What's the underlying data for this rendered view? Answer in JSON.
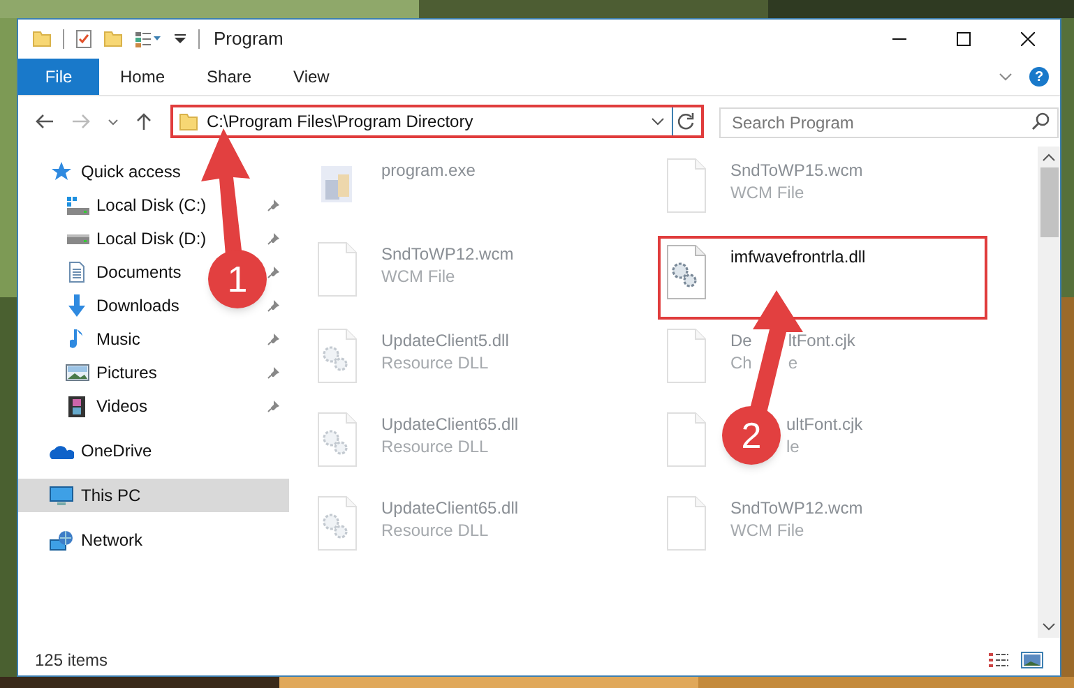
{
  "window": {
    "title": "Program"
  },
  "ribbon": {
    "tabs": [
      {
        "label": "File",
        "kind": "file",
        "selected": false
      },
      {
        "label": "Home",
        "kind": "tab",
        "selected": false
      },
      {
        "label": "Share",
        "kind": "tab",
        "selected": false
      },
      {
        "label": "View",
        "kind": "tab",
        "selected": false
      }
    ],
    "help": "?"
  },
  "address": {
    "path": "C:\\Program Files\\Program Directory",
    "highlighted": true
  },
  "search": {
    "placeholder": "Search Program"
  },
  "nav": [
    {
      "label": "Quick access",
      "kind": "star",
      "selected": false,
      "children": [
        {
          "label": "Local Disk (C:)",
          "kind": "drive_windows",
          "pinned": true,
          "selected": false
        },
        {
          "label": "Local Disk (D:)",
          "kind": "drive",
          "pinned": true,
          "selected": false
        },
        {
          "label": "Documents",
          "kind": "documents",
          "pinned": true,
          "selected": false
        },
        {
          "label": "Downloads",
          "kind": "downloads",
          "pinned": true,
          "selected": false
        },
        {
          "label": "Music",
          "kind": "music",
          "pinned": true,
          "selected": false
        },
        {
          "label": "Pictures",
          "kind": "pictures",
          "pinned": true,
          "selected": false
        },
        {
          "label": "Videos",
          "kind": "videos",
          "pinned": true,
          "selected": false
        }
      ]
    },
    {
      "label": "OneDrive",
      "kind": "cloud",
      "selected": false
    },
    {
      "label": "This PC",
      "kind": "pc",
      "selected": true
    },
    {
      "label": "Network",
      "kind": "network",
      "selected": false
    }
  ],
  "files": [
    {
      "name": "program.exe",
      "kind": "exe",
      "dimmed": true,
      "highlighted": false
    },
    {
      "name": "SndToWP15.wcm",
      "type": "WCM File",
      "kind": "document",
      "dimmed": true,
      "highlighted": false
    },
    {
      "name": "SndToWP12.wcm",
      "type": "WCM File",
      "kind": "document",
      "dimmed": true,
      "highlighted": false
    },
    {
      "name": "imfwavefrontrla.dll",
      "kind": "dll",
      "dimmed": false,
      "highlighted": true
    },
    {
      "name": "UpdateClient5.dll",
      "type": "Resource DLL",
      "kind": "dll",
      "dimmed": true,
      "highlighted": false
    },
    {
      "name": "De",
      "name_tail": "ltFont.cjk",
      "type": "Ch",
      "type_tail": "e",
      "kind": "document",
      "dimmed": true,
      "highlighted": false
    },
    {
      "name": "UpdateClient65.dll",
      "type": "Resource DLL",
      "kind": "dll",
      "dimmed": true,
      "highlighted": false
    },
    {
      "name_tail": "ultFont.cjk",
      "type_tail": "le",
      "kind": "document",
      "dimmed": true,
      "highlighted": false
    },
    {
      "name": "UpdateClient65.dll",
      "type": "Resource DLL",
      "kind": "dll",
      "dimmed": true,
      "highlighted": false
    },
    {
      "name": "SndToWP12.wcm",
      "type": "WCM File",
      "kind": "document",
      "dimmed": true,
      "highlighted": false
    }
  ],
  "status_bar": {
    "count": "125 items"
  },
  "callouts": [
    {
      "number": "1"
    },
    {
      "number": "2"
    }
  ]
}
